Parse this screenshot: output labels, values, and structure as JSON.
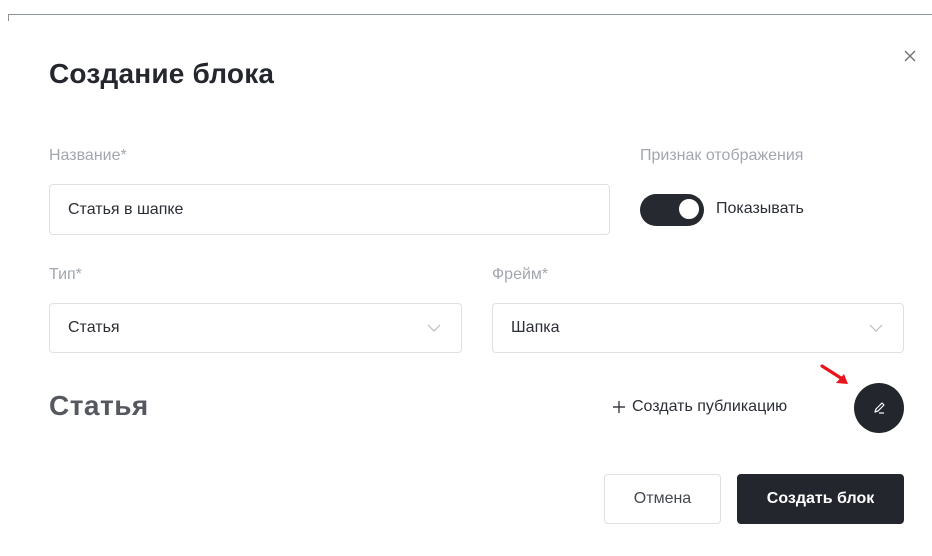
{
  "modal": {
    "title": "Создание блока"
  },
  "form": {
    "name_label": "Название*",
    "name_value": "Статья в шапке",
    "display_label": "Признак отображения",
    "toggle_on": true,
    "toggle_text": "Показывать",
    "type_label": "Тип*",
    "type_value": "Статья",
    "frame_label": "Фрейм*",
    "frame_value": "Шапка"
  },
  "section": {
    "title": "Статья",
    "create_publication": "Создать публикацию"
  },
  "buttons": {
    "cancel": "Отмена",
    "create": "Создать блок"
  },
  "icons": {
    "close": "close-icon",
    "plus": "plus-icon",
    "edit": "pencil-icon",
    "chevron": "chevron-down-icon",
    "annotation_arrow": "red-arrow-icon"
  },
  "colors": {
    "primary_dark": "#23262c",
    "arrow": "#e8141c"
  }
}
